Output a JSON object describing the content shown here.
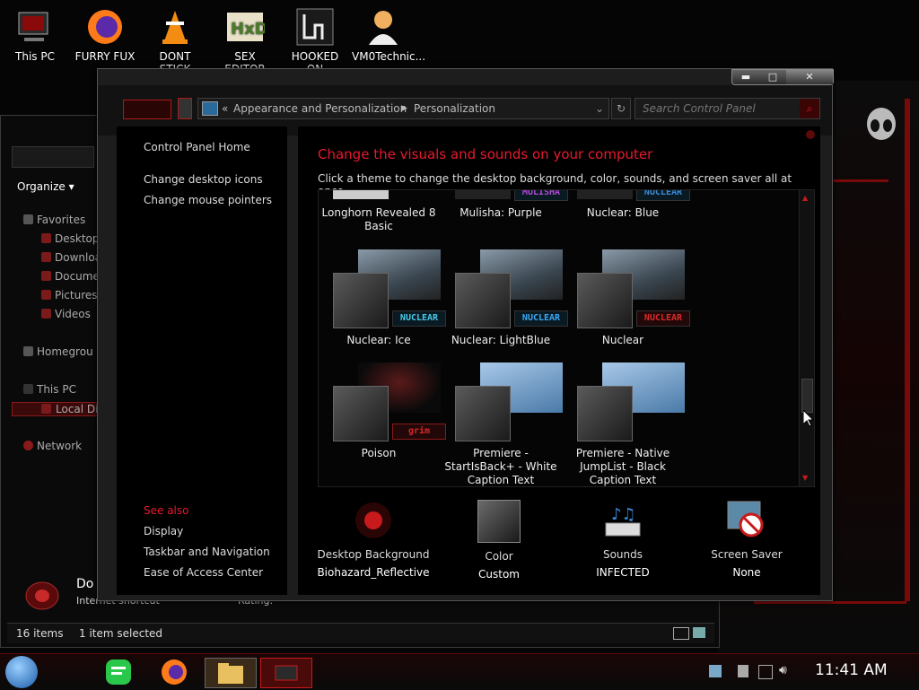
{
  "desktop": {
    "icons": [
      {
        "label": "This PC"
      },
      {
        "label": "FURRY FUX"
      },
      {
        "label": "DONT STICK"
      },
      {
        "label": "SEX EDITOR"
      },
      {
        "label": "HOOKED ON"
      },
      {
        "label": "VM0Technic..."
      }
    ]
  },
  "bg_window": {
    "organize": "Organize",
    "nav": [
      {
        "label": "Favorites"
      },
      {
        "label": "Desktop"
      },
      {
        "label": "Downloa"
      },
      {
        "label": "Documer"
      },
      {
        "label": "Pictures"
      },
      {
        "label": "Videos"
      },
      {
        "label": "Homegrou"
      },
      {
        "label": "This PC"
      },
      {
        "label": "Local Dis"
      },
      {
        "label": "Network"
      }
    ],
    "detail_name": "Do",
    "detail_sub": "Internet shortcut",
    "detail_rating": "Rating:",
    "status_count": "16 items",
    "status_selected": "1 item selected"
  },
  "window": {
    "breadcrumb_root": "«",
    "breadcrumb": [
      "Appearance and Personalization",
      "Personalization"
    ],
    "search_placeholder": "Search Control Panel",
    "left_links": {
      "home": "Control Panel Home",
      "desktop_icons": "Change desktop icons",
      "mouse_pointers": "Change mouse pointers",
      "see_also": "See also",
      "display": "Display",
      "taskbar": "Taskbar and Navigation",
      "ease": "Ease of Access Center"
    },
    "heading": "Change the visuals and sounds on your computer",
    "subheading": "Click a theme to change the desktop background, color, sounds, and screen saver all at once.",
    "themes": [
      {
        "label": "Longhorn Revealed 8 Basic",
        "badge": ""
      },
      {
        "label": "Mulisha: Purple",
        "badge": "MULISHA"
      },
      {
        "label": "Nuclear: Blue",
        "badge": "NUCLEAR"
      },
      {
        "label": "Nuclear: Ice",
        "badge": "NUCLEAR"
      },
      {
        "label": "Nuclear: LightBlue",
        "badge": "NUCLEAR"
      },
      {
        "label": "Nuclear",
        "badge": "NUCLEAR"
      },
      {
        "label": "Poison",
        "badge": "grim"
      },
      {
        "label": "Premiere - StartIsBack+ - White Caption Text",
        "badge": ""
      },
      {
        "label": "Premiere - Native JumpList - Black Caption Text",
        "badge": ""
      }
    ],
    "bottom": [
      {
        "title": "Desktop Background",
        "value": "Biohazard_Reflective"
      },
      {
        "title": "Color",
        "value": "Custom"
      },
      {
        "title": "Sounds",
        "value": "INFECTED"
      },
      {
        "title": "Screen Saver",
        "value": "None"
      }
    ]
  },
  "taskbar": {
    "clock": "11:41 AM"
  },
  "colors": {
    "accent_red": "#e8192c",
    "window_bg": "#000000"
  }
}
